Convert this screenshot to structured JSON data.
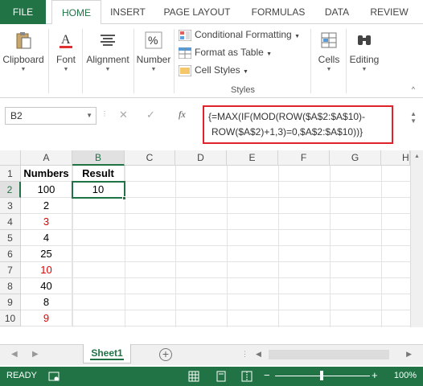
{
  "ribbon_tabs": [
    "FILE",
    "HOME",
    "INSERT",
    "PAGE LAYOUT",
    "FORMULAS",
    "DATA",
    "REVIEW"
  ],
  "ribbon_groups": {
    "clipboard": "Clipboard",
    "font": "Font",
    "alignment": "Alignment",
    "number": "Number",
    "cells": "Cells",
    "editing": "Editing",
    "styles": {
      "items": [
        "Conditional Formatting",
        "Format as Table",
        "Cell Styles"
      ],
      "group_label": "Styles"
    }
  },
  "formula_bar": {
    "name_box": "B2",
    "cancel_symbol": "✕",
    "enter_symbol": "✓",
    "fx_label": "fx",
    "formula_line1": "{=MAX(IF(MOD(ROW($A$2:$A$10)-",
    "formula_line2": "ROW($A$2)+1,3)=0,$A$2:$A$10))}"
  },
  "columns": [
    "A",
    "B",
    "C",
    "D",
    "E",
    "F",
    "G",
    "H"
  ],
  "rows": [
    "1",
    "2",
    "3",
    "4",
    "5",
    "6",
    "7",
    "8",
    "9",
    "10"
  ],
  "headers": {
    "a1": "Numbers",
    "b1": "Result"
  },
  "numbers": [
    "100",
    "2",
    "3",
    "4",
    "25",
    "10",
    "40",
    "8",
    "9"
  ],
  "result": "10",
  "sheet_tab": "Sheet1",
  "status": {
    "ready": "READY",
    "zoom": "100%"
  },
  "colors": {
    "accent": "#217346",
    "highlight": "#e0232a",
    "red_text": "#e00000"
  }
}
